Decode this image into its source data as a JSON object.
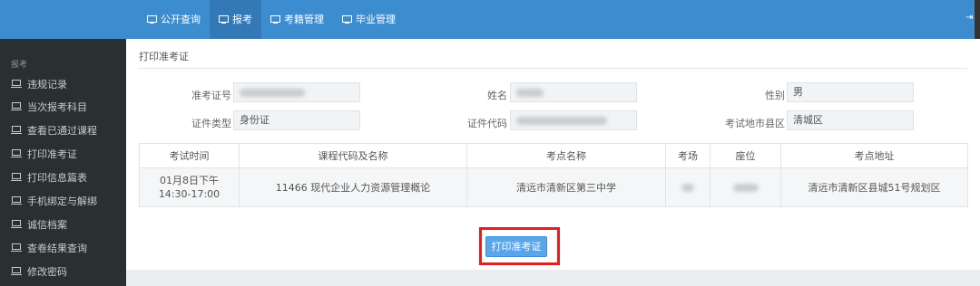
{
  "topnav": {
    "items": [
      {
        "label": "公开查询",
        "icon": "monitor-icon",
        "active": false
      },
      {
        "label": "报考",
        "icon": "monitor-icon",
        "active": true
      },
      {
        "label": "考籍管理",
        "icon": "monitor-icon",
        "active": false
      },
      {
        "label": "毕业管理",
        "icon": "monitor-icon",
        "active": false
      }
    ],
    "logout_icon": "sign-out-icon"
  },
  "sidebar": {
    "header": "报考",
    "items": [
      {
        "label": "违规记录"
      },
      {
        "label": "当次报考科目"
      },
      {
        "label": "查看已通过课程"
      },
      {
        "label": "打印准考证"
      },
      {
        "label": "打印信息篇表"
      },
      {
        "label": "手机绑定与解绑"
      },
      {
        "label": "诚信档案"
      },
      {
        "label": "查卷结果查询"
      },
      {
        "label": "修改密码"
      }
    ]
  },
  "page": {
    "title": "打印准考证"
  },
  "form": {
    "admission_no_label": "准考证号",
    "admission_no_value": "",
    "name_label": "姓名",
    "name_value": "",
    "gender_label": "性别",
    "gender_value": "男",
    "id_type_label": "证件类型",
    "id_type_value": "身份证",
    "id_no_label": "证件代码",
    "id_no_value": "",
    "region_label": "考试地市县区",
    "region_value": "清城区"
  },
  "exam_table": {
    "headers": [
      "考试时间",
      "课程代码及名称",
      "考点名称",
      "考场",
      "座位",
      "考点地址"
    ],
    "rows": [
      {
        "time_date": "01月8日下午",
        "time_range": "14:30-17:00",
        "course": "11466 现代企业人力资源管理概论",
        "site": "清远市清新区第三中学",
        "room": "",
        "seat": "",
        "address": "清远市清新区县城51号规划区"
      }
    ]
  },
  "actions": {
    "print_label": "打印准考证"
  },
  "colors": {
    "topbar": "#3c8dd0",
    "topbar_active": "#3379b8",
    "sidebar": "#2a3032",
    "button": "#5aa6ea",
    "highlight": "#e02020"
  }
}
